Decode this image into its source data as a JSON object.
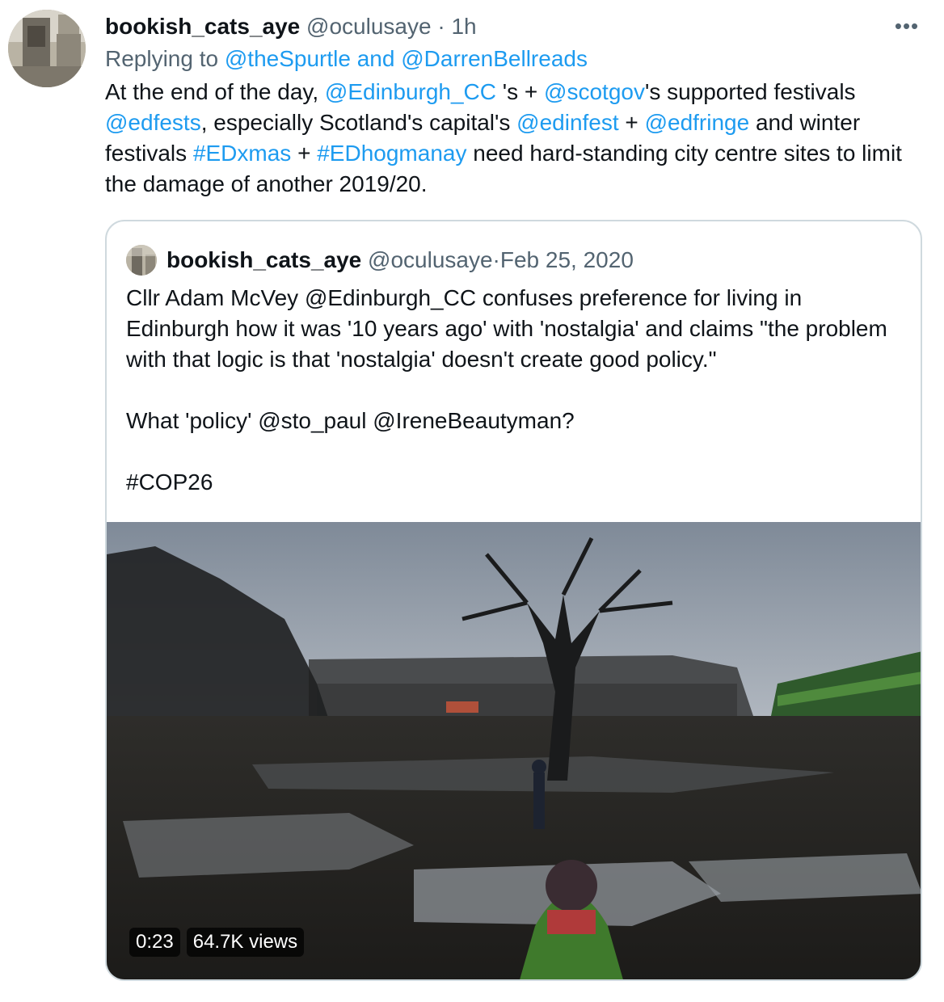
{
  "tweet": {
    "display_name": "bookish_cats_aye",
    "handle": "@oculusaye",
    "separator": " · ",
    "time": "1h",
    "replying_prefix": "Replying to ",
    "replying_to_1": "@theSpurtle",
    "replying_joiner": " and ",
    "replying_to_2": "@DarrenBellreads",
    "text": {
      "t1": "At the end of the day, ",
      "m1": "@Edinburgh_CC",
      "t2": " 's + ",
      "m2": "@scotgov",
      "t3": "'s supported festivals ",
      "m3": "@edfests",
      "t4": ", especially Scotland's capital's ",
      "m4": "@edinfest",
      "t5": " + ",
      "m5": "@edfringe",
      "t6": " and winter festivals ",
      "h1": "#EDxmas",
      "t7": " + ",
      "h2": "#EDhogmanay",
      "t8": " need hard-standing city centre sites to limit the damage of another 2019/20."
    },
    "more_icon": "more-dots-icon"
  },
  "quoted_tweet": {
    "display_name": "bookish_cats_aye",
    "handle": "@oculusaye",
    "separator": " · ",
    "date": "Feb 25, 2020",
    "paragraph_1": "Cllr Adam McVey @Edinburgh_CC confuses preference for living in Edinburgh how it was '10 years ago' with 'nostalgia' and claims \"the problem with that logic is that 'nostalgia' doesn't create good policy.\"",
    "paragraph_2": "What 'policy' @sto_paul @IreneBeautyman?",
    "paragraph_3": "#COP26",
    "video": {
      "duration": "0:23",
      "views": "64.7K views"
    }
  },
  "colors": {
    "link": "#1d9bf0",
    "muted": "#536471",
    "text": "#0f1419",
    "border": "#cfd9de"
  }
}
